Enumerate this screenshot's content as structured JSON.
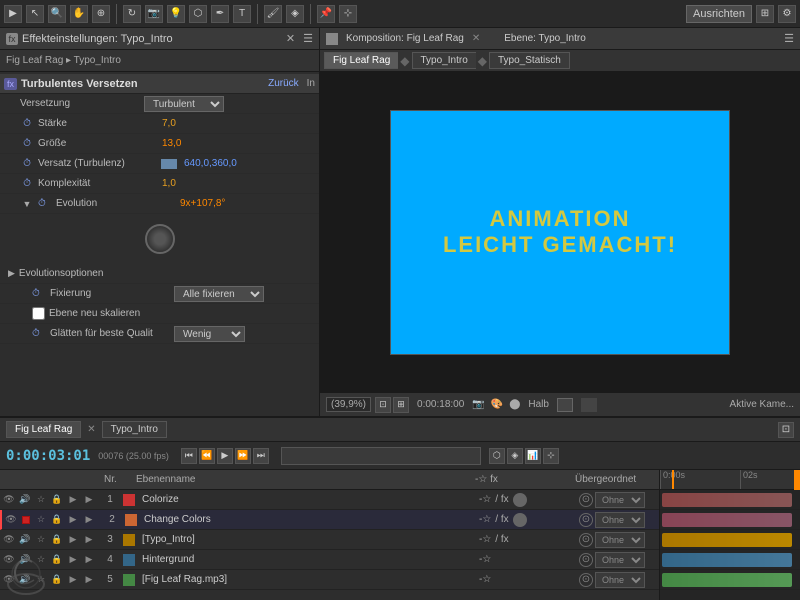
{
  "topbar": {
    "ausrichten": "Ausrichten"
  },
  "effectPanel": {
    "title": "Effekteinstellungen: Typo_Intro",
    "breadcrumb": "Fig Leaf Rag ▸ Typo_Intro",
    "section": "Turbulentes Versetzen",
    "back_label": "Zurück",
    "in_label": "In",
    "rows": [
      {
        "label": "Versetzung",
        "value": "Turbulent",
        "type": "dropdown"
      },
      {
        "label": "Stärke",
        "value": "7,0",
        "type": "orange"
      },
      {
        "label": "Größe",
        "value": "13,0",
        "type": "orange"
      },
      {
        "label": "Versatz (Turbulenz)",
        "value": "640,0,360,0",
        "type": "blue"
      },
      {
        "label": "Komplexität",
        "value": "1,0",
        "type": "orange"
      },
      {
        "label": "Evolution",
        "value": "9x+107,8°",
        "type": "orange"
      }
    ],
    "evolutionOptions": "Evolutionsoptionen",
    "fixierung_label": "Fixierung",
    "fixierung_value": "Alle fixieren",
    "ebene_label": "Ebene neu skalieren",
    "glaetten_label": "Glätten für beste Qualit",
    "glaetten_value": "Wenig"
  },
  "composition": {
    "header_title": "Komposition: Fig Leaf Rag",
    "ebene_label": "Ebene: Typo_Intro",
    "tabs": [
      {
        "label": "Fig Leaf Rag",
        "active": true
      },
      {
        "label": "Typo_Intro",
        "active": false
      },
      {
        "label": "Typo_Statisch",
        "active": false
      }
    ],
    "preview_text_line1": "ANIMATION",
    "preview_text_line2": "LEICHT GEMACHT!",
    "zoom": "(39,9%)",
    "timecode": "0:00:18:00",
    "quality": "Halb",
    "camera": "Aktive Kame..."
  },
  "timeline": {
    "tabs": [
      {
        "label": "Fig Leaf Rag",
        "active": true
      },
      {
        "label": "Typo_Intro",
        "active": false
      }
    ],
    "time": "0:00:03:01",
    "frames": "00076 (25.00 fps)",
    "ruler_marks": [
      "0:00s",
      "02s"
    ],
    "columns": {
      "nr": "Nr.",
      "ebenenname": "Ebenenname",
      "uebergeordnet": "Übergeordnet"
    },
    "layers": [
      {
        "num": "1",
        "name": "Colorize",
        "color": "#cc3333",
        "type": "solid",
        "parent": "Ohne"
      },
      {
        "num": "2",
        "name": "Change Colors",
        "color": "#cc6633",
        "type": "solid",
        "parent": "Ohne"
      },
      {
        "num": "3",
        "name": "[Typo_Intro]",
        "color": "#aa7700",
        "type": "comp",
        "parent": "Ohne"
      },
      {
        "num": "4",
        "name": "Hintergrund",
        "color": "#336688",
        "type": "solid",
        "parent": "Ohne"
      },
      {
        "num": "5",
        "name": "[Fig Leaf Rag.mp3]",
        "color": "#448844",
        "type": "audio",
        "parent": "Ohne"
      }
    ]
  }
}
